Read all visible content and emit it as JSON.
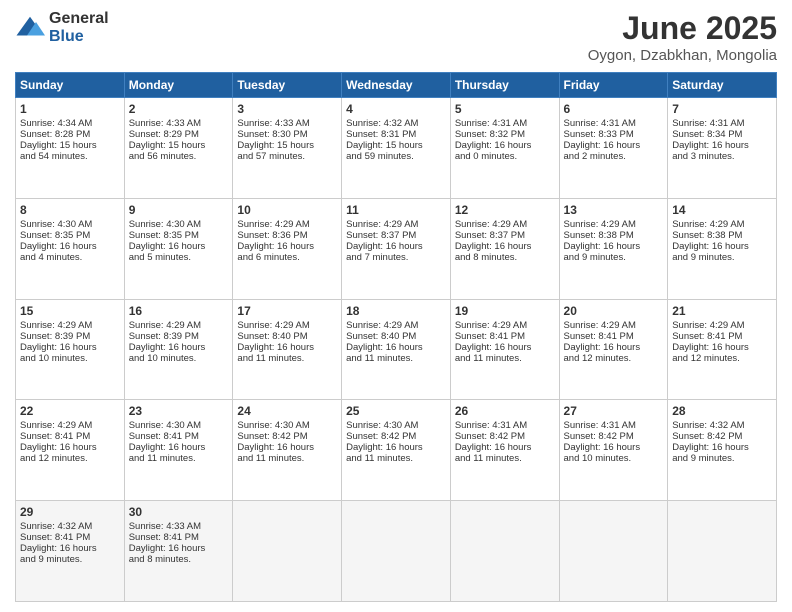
{
  "logo": {
    "general": "General",
    "blue": "Blue"
  },
  "title": {
    "month": "June 2025",
    "location": "Oygon, Dzabkhan, Mongolia"
  },
  "days": [
    "Sunday",
    "Monday",
    "Tuesday",
    "Wednesday",
    "Thursday",
    "Friday",
    "Saturday"
  ],
  "weeks": [
    [
      {
        "num": "1",
        "lines": [
          "Sunrise: 4:34 AM",
          "Sunset: 8:28 PM",
          "Daylight: 15 hours",
          "and 54 minutes."
        ]
      },
      {
        "num": "2",
        "lines": [
          "Sunrise: 4:33 AM",
          "Sunset: 8:29 PM",
          "Daylight: 15 hours",
          "and 56 minutes."
        ]
      },
      {
        "num": "3",
        "lines": [
          "Sunrise: 4:33 AM",
          "Sunset: 8:30 PM",
          "Daylight: 15 hours",
          "and 57 minutes."
        ]
      },
      {
        "num": "4",
        "lines": [
          "Sunrise: 4:32 AM",
          "Sunset: 8:31 PM",
          "Daylight: 15 hours",
          "and 59 minutes."
        ]
      },
      {
        "num": "5",
        "lines": [
          "Sunrise: 4:31 AM",
          "Sunset: 8:32 PM",
          "Daylight: 16 hours",
          "and 0 minutes."
        ]
      },
      {
        "num": "6",
        "lines": [
          "Sunrise: 4:31 AM",
          "Sunset: 8:33 PM",
          "Daylight: 16 hours",
          "and 2 minutes."
        ]
      },
      {
        "num": "7",
        "lines": [
          "Sunrise: 4:31 AM",
          "Sunset: 8:34 PM",
          "Daylight: 16 hours",
          "and 3 minutes."
        ]
      }
    ],
    [
      {
        "num": "8",
        "lines": [
          "Sunrise: 4:30 AM",
          "Sunset: 8:35 PM",
          "Daylight: 16 hours",
          "and 4 minutes."
        ]
      },
      {
        "num": "9",
        "lines": [
          "Sunrise: 4:30 AM",
          "Sunset: 8:35 PM",
          "Daylight: 16 hours",
          "and 5 minutes."
        ]
      },
      {
        "num": "10",
        "lines": [
          "Sunrise: 4:29 AM",
          "Sunset: 8:36 PM",
          "Daylight: 16 hours",
          "and 6 minutes."
        ]
      },
      {
        "num": "11",
        "lines": [
          "Sunrise: 4:29 AM",
          "Sunset: 8:37 PM",
          "Daylight: 16 hours",
          "and 7 minutes."
        ]
      },
      {
        "num": "12",
        "lines": [
          "Sunrise: 4:29 AM",
          "Sunset: 8:37 PM",
          "Daylight: 16 hours",
          "and 8 minutes."
        ]
      },
      {
        "num": "13",
        "lines": [
          "Sunrise: 4:29 AM",
          "Sunset: 8:38 PM",
          "Daylight: 16 hours",
          "and 9 minutes."
        ]
      },
      {
        "num": "14",
        "lines": [
          "Sunrise: 4:29 AM",
          "Sunset: 8:38 PM",
          "Daylight: 16 hours",
          "and 9 minutes."
        ]
      }
    ],
    [
      {
        "num": "15",
        "lines": [
          "Sunrise: 4:29 AM",
          "Sunset: 8:39 PM",
          "Daylight: 16 hours",
          "and 10 minutes."
        ]
      },
      {
        "num": "16",
        "lines": [
          "Sunrise: 4:29 AM",
          "Sunset: 8:39 PM",
          "Daylight: 16 hours",
          "and 10 minutes."
        ]
      },
      {
        "num": "17",
        "lines": [
          "Sunrise: 4:29 AM",
          "Sunset: 8:40 PM",
          "Daylight: 16 hours",
          "and 11 minutes."
        ]
      },
      {
        "num": "18",
        "lines": [
          "Sunrise: 4:29 AM",
          "Sunset: 8:40 PM",
          "Daylight: 16 hours",
          "and 11 minutes."
        ]
      },
      {
        "num": "19",
        "lines": [
          "Sunrise: 4:29 AM",
          "Sunset: 8:41 PM",
          "Daylight: 16 hours",
          "and 11 minutes."
        ]
      },
      {
        "num": "20",
        "lines": [
          "Sunrise: 4:29 AM",
          "Sunset: 8:41 PM",
          "Daylight: 16 hours",
          "and 12 minutes."
        ]
      },
      {
        "num": "21",
        "lines": [
          "Sunrise: 4:29 AM",
          "Sunset: 8:41 PM",
          "Daylight: 16 hours",
          "and 12 minutes."
        ]
      }
    ],
    [
      {
        "num": "22",
        "lines": [
          "Sunrise: 4:29 AM",
          "Sunset: 8:41 PM",
          "Daylight: 16 hours",
          "and 12 minutes."
        ]
      },
      {
        "num": "23",
        "lines": [
          "Sunrise: 4:30 AM",
          "Sunset: 8:41 PM",
          "Daylight: 16 hours",
          "and 11 minutes."
        ]
      },
      {
        "num": "24",
        "lines": [
          "Sunrise: 4:30 AM",
          "Sunset: 8:42 PM",
          "Daylight: 16 hours",
          "and 11 minutes."
        ]
      },
      {
        "num": "25",
        "lines": [
          "Sunrise: 4:30 AM",
          "Sunset: 8:42 PM",
          "Daylight: 16 hours",
          "and 11 minutes."
        ]
      },
      {
        "num": "26",
        "lines": [
          "Sunrise: 4:31 AM",
          "Sunset: 8:42 PM",
          "Daylight: 16 hours",
          "and 11 minutes."
        ]
      },
      {
        "num": "27",
        "lines": [
          "Sunrise: 4:31 AM",
          "Sunset: 8:42 PM",
          "Daylight: 16 hours",
          "and 10 minutes."
        ]
      },
      {
        "num": "28",
        "lines": [
          "Sunrise: 4:32 AM",
          "Sunset: 8:42 PM",
          "Daylight: 16 hours",
          "and 9 minutes."
        ]
      }
    ],
    [
      {
        "num": "29",
        "lines": [
          "Sunrise: 4:32 AM",
          "Sunset: 8:41 PM",
          "Daylight: 16 hours",
          "and 9 minutes."
        ]
      },
      {
        "num": "30",
        "lines": [
          "Sunrise: 4:33 AM",
          "Sunset: 8:41 PM",
          "Daylight: 16 hours",
          "and 8 minutes."
        ]
      },
      null,
      null,
      null,
      null,
      null
    ]
  ]
}
